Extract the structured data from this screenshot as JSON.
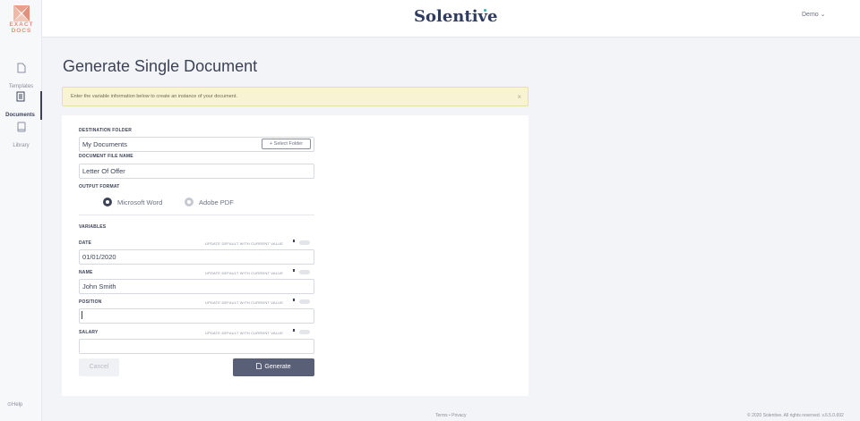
{
  "logo": {
    "line1": "EXACT",
    "line2": "DOCS"
  },
  "sidebar": {
    "items": [
      {
        "label": "Templates",
        "icon": "file-icon"
      },
      {
        "label": "Documents",
        "icon": "document-icon"
      },
      {
        "label": "Library",
        "icon": "book-icon"
      }
    ],
    "help_label": "Help"
  },
  "header": {
    "brand": "Solentive",
    "user": "Demo ⌄"
  },
  "page": {
    "title": "Generate Single Document"
  },
  "alert": {
    "text": "Enter the variable information below to create an instance of your document.",
    "close": "×"
  },
  "form": {
    "destination_label": "DESTINATION FOLDER",
    "destination_value": "My Documents",
    "select_folder_label": "+ Select Folder",
    "file_name_label": "DOCUMENT FILE NAME",
    "file_name_value": "Letter Of Offer",
    "output_format_label": "OUTPUT FORMAT",
    "format_word": "Microsoft Word",
    "format_pdf": "Adobe PDF",
    "variables_label": "VARIABLES",
    "update_default_label": "UPDATE DEFAULT WITH CURRENT VALUE",
    "variables": [
      {
        "name": "DATE",
        "value": "01/01/2020"
      },
      {
        "name": "NAME",
        "value": "John Smith"
      },
      {
        "name": "POSITION",
        "value": ""
      },
      {
        "name": "SALARY",
        "value": ""
      }
    ],
    "cancel_label": "Cancel",
    "generate_label": "Generate"
  },
  "footer": {
    "links": "Terms • Privacy",
    "copyright": "© 2020 Solentive. All rights reserved. v.6.5.0.692"
  },
  "colors": {
    "accent": "#5a5f78",
    "alert_bg": "#f8f3d2",
    "brand": "#2f3c5f",
    "logo": "#e0907c"
  }
}
